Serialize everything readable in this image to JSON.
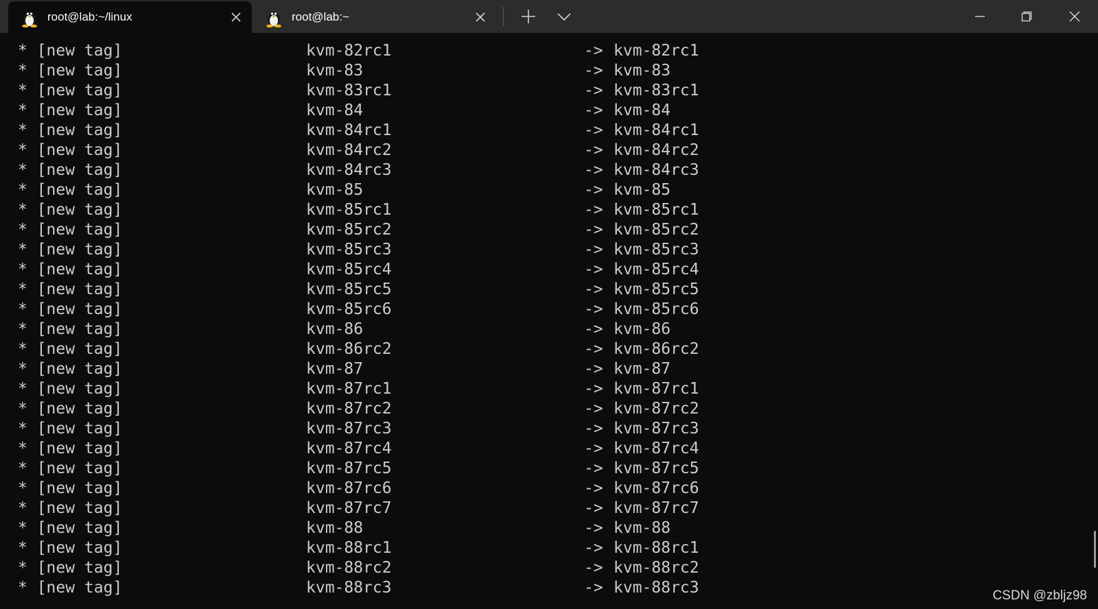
{
  "tabs": [
    {
      "title": "root@lab:~/linux",
      "icon": "linux-penguin-icon",
      "active": true
    },
    {
      "title": "root@lab:~",
      "icon": "linux-penguin-icon",
      "active": false
    }
  ],
  "terminal": {
    "lines": [
      {
        "prefix": "* [new tag]",
        "ref": "kvm-82rc1",
        "arrow": "->",
        "dest": "kvm-82rc1"
      },
      {
        "prefix": "* [new tag]",
        "ref": "kvm-83",
        "arrow": "->",
        "dest": "kvm-83"
      },
      {
        "prefix": "* [new tag]",
        "ref": "kvm-83rc1",
        "arrow": "->",
        "dest": "kvm-83rc1"
      },
      {
        "prefix": "* [new tag]",
        "ref": "kvm-84",
        "arrow": "->",
        "dest": "kvm-84"
      },
      {
        "prefix": "* [new tag]",
        "ref": "kvm-84rc1",
        "arrow": "->",
        "dest": "kvm-84rc1"
      },
      {
        "prefix": "* [new tag]",
        "ref": "kvm-84rc2",
        "arrow": "->",
        "dest": "kvm-84rc2"
      },
      {
        "prefix": "* [new tag]",
        "ref": "kvm-84rc3",
        "arrow": "->",
        "dest": "kvm-84rc3"
      },
      {
        "prefix": "* [new tag]",
        "ref": "kvm-85",
        "arrow": "->",
        "dest": "kvm-85"
      },
      {
        "prefix": "* [new tag]",
        "ref": "kvm-85rc1",
        "arrow": "->",
        "dest": "kvm-85rc1"
      },
      {
        "prefix": "* [new tag]",
        "ref": "kvm-85rc2",
        "arrow": "->",
        "dest": "kvm-85rc2"
      },
      {
        "prefix": "* [new tag]",
        "ref": "kvm-85rc3",
        "arrow": "->",
        "dest": "kvm-85rc3"
      },
      {
        "prefix": "* [new tag]",
        "ref": "kvm-85rc4",
        "arrow": "->",
        "dest": "kvm-85rc4"
      },
      {
        "prefix": "* [new tag]",
        "ref": "kvm-85rc5",
        "arrow": "->",
        "dest": "kvm-85rc5"
      },
      {
        "prefix": "* [new tag]",
        "ref": "kvm-85rc6",
        "arrow": "->",
        "dest": "kvm-85rc6"
      },
      {
        "prefix": "* [new tag]",
        "ref": "kvm-86",
        "arrow": "->",
        "dest": "kvm-86"
      },
      {
        "prefix": "* [new tag]",
        "ref": "kvm-86rc2",
        "arrow": "->",
        "dest": "kvm-86rc2"
      },
      {
        "prefix": "* [new tag]",
        "ref": "kvm-87",
        "arrow": "->",
        "dest": "kvm-87"
      },
      {
        "prefix": "* [new tag]",
        "ref": "kvm-87rc1",
        "arrow": "->",
        "dest": "kvm-87rc1"
      },
      {
        "prefix": "* [new tag]",
        "ref": "kvm-87rc2",
        "arrow": "->",
        "dest": "kvm-87rc2"
      },
      {
        "prefix": "* [new tag]",
        "ref": "kvm-87rc3",
        "arrow": "->",
        "dest": "kvm-87rc3"
      },
      {
        "prefix": "* [new tag]",
        "ref": "kvm-87rc4",
        "arrow": "->",
        "dest": "kvm-87rc4"
      },
      {
        "prefix": "* [new tag]",
        "ref": "kvm-87rc5",
        "arrow": "->",
        "dest": "kvm-87rc5"
      },
      {
        "prefix": "* [new tag]",
        "ref": "kvm-87rc6",
        "arrow": "->",
        "dest": "kvm-87rc6"
      },
      {
        "prefix": "* [new tag]",
        "ref": "kvm-87rc7",
        "arrow": "->",
        "dest": "kvm-87rc7"
      },
      {
        "prefix": "* [new tag]",
        "ref": "kvm-88",
        "arrow": "->",
        "dest": "kvm-88"
      },
      {
        "prefix": "* [new tag]",
        "ref": "kvm-88rc1",
        "arrow": "->",
        "dest": "kvm-88rc1"
      },
      {
        "prefix": "* [new tag]",
        "ref": "kvm-88rc2",
        "arrow": "->",
        "dest": "kvm-88rc2"
      },
      {
        "prefix": "* [new tag]",
        "ref": "kvm-88rc3",
        "arrow": "->",
        "dest": "kvm-88rc3"
      }
    ]
  },
  "watermark": "CSDN @zbljz98",
  "colors": {
    "titlebar": "#2c2c2c",
    "terminal_bg": "#0c0c0c",
    "terminal_text": "#cccccc"
  }
}
